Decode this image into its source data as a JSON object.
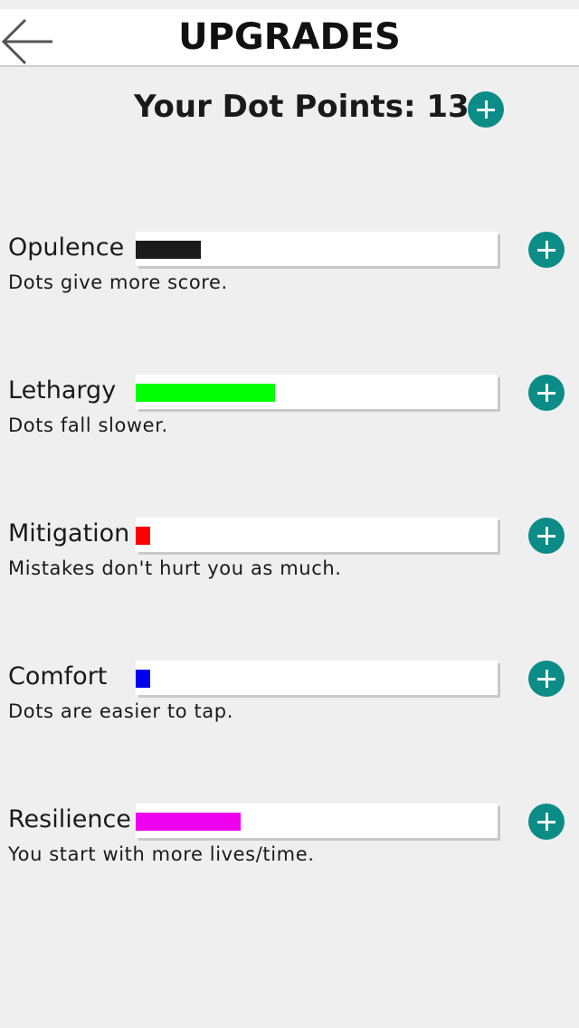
{
  "header": {
    "title": "UPGRADES"
  },
  "points": {
    "label": "Your Dot Points: 13"
  },
  "upgrades": [
    {
      "name": "Opulence",
      "description": "Dots give more score.",
      "level": 0.18,
      "color": "#1a1a1a"
    },
    {
      "name": "Lethargy",
      "description": "Dots fall slower.",
      "level": 0.385,
      "color": "#00ff00"
    },
    {
      "name": "Mitigation",
      "description": "Mistakes don't hurt you as much.",
      "level": 0.04,
      "color": "#ff0000"
    },
    {
      "name": "Comfort",
      "description": "Dots are easier to tap.",
      "level": 0.04,
      "color": "#0000ee"
    },
    {
      "name": "Resilience",
      "description": "You start with more lives/time.",
      "level": 0.29,
      "color": "#ee00ee"
    }
  ],
  "icons": {
    "back": "back-arrow-icon",
    "add": "plus-circle-icon"
  },
  "colors": {
    "accent": "#0b8c87",
    "background": "#efefef"
  }
}
